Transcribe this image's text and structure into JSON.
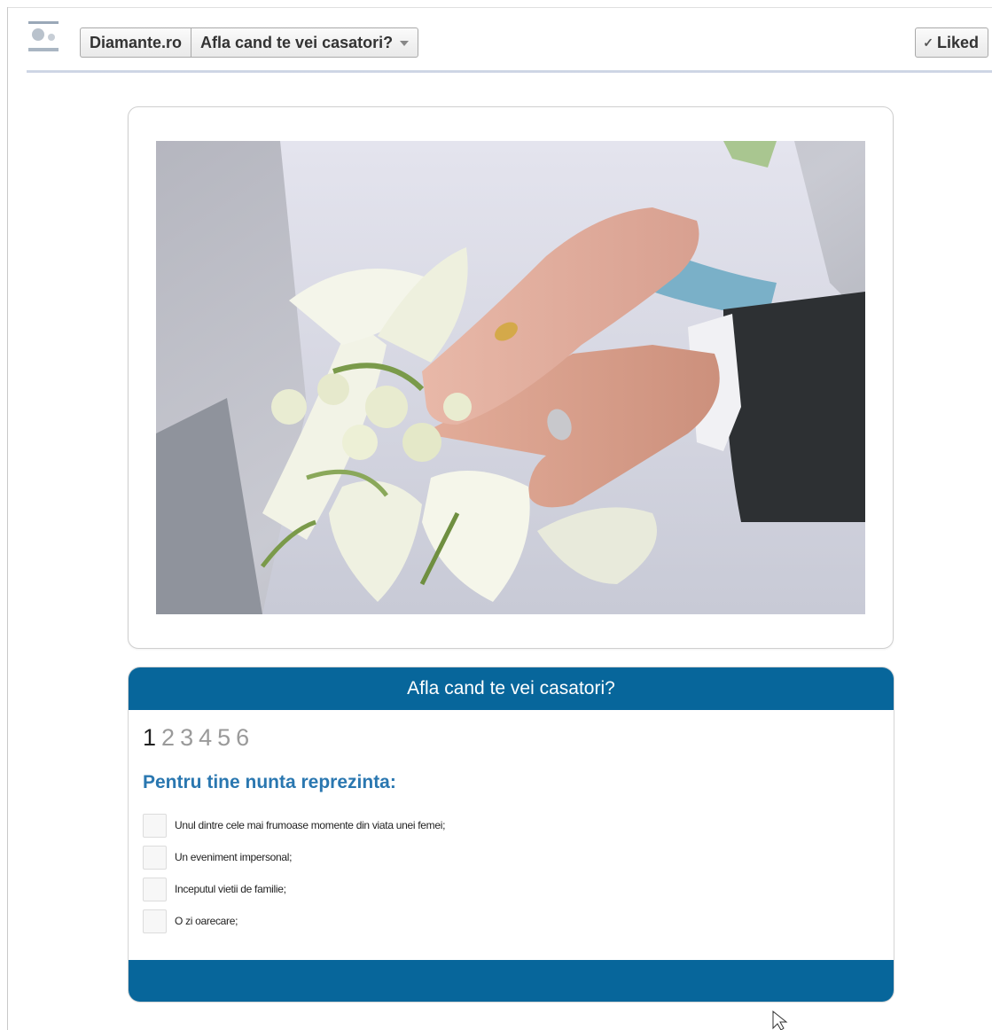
{
  "header": {
    "page_name": "Diamante.ro",
    "app_name": "Afla cand te vei casatori?",
    "liked_label": "Liked",
    "liked_icon": "check-icon",
    "menu_icon": "chevron-down-icon"
  },
  "quiz": {
    "title": "Afla cand te vei casatori?",
    "steps": [
      "1",
      "2",
      "3",
      "4",
      "5",
      "6"
    ],
    "active_step": "1",
    "question": "Pentru tine nunta reprezinta:",
    "options": [
      "Unul dintre cele mai frumoase momente din viata unei femei;",
      "Un eveniment impersonal;",
      "Inceputul vietii de familie;",
      "O zi oarecare;"
    ]
  },
  "colors": {
    "quiz_header": "#07669b",
    "question_text": "#2a77b0"
  }
}
